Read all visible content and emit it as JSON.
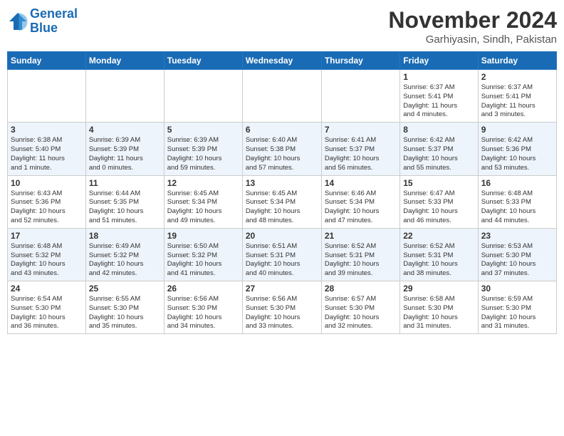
{
  "header": {
    "logo_line1": "General",
    "logo_line2": "Blue",
    "month": "November 2024",
    "location": "Garhiyasin, Sindh, Pakistan"
  },
  "weekdays": [
    "Sunday",
    "Monday",
    "Tuesday",
    "Wednesday",
    "Thursday",
    "Friday",
    "Saturday"
  ],
  "weeks": [
    [
      {
        "day": "",
        "info": ""
      },
      {
        "day": "",
        "info": ""
      },
      {
        "day": "",
        "info": ""
      },
      {
        "day": "",
        "info": ""
      },
      {
        "day": "",
        "info": ""
      },
      {
        "day": "1",
        "info": "Sunrise: 6:37 AM\nSunset: 5:41 PM\nDaylight: 11 hours\nand 4 minutes."
      },
      {
        "day": "2",
        "info": "Sunrise: 6:37 AM\nSunset: 5:41 PM\nDaylight: 11 hours\nand 3 minutes."
      }
    ],
    [
      {
        "day": "3",
        "info": "Sunrise: 6:38 AM\nSunset: 5:40 PM\nDaylight: 11 hours\nand 1 minute."
      },
      {
        "day": "4",
        "info": "Sunrise: 6:39 AM\nSunset: 5:39 PM\nDaylight: 11 hours\nand 0 minutes."
      },
      {
        "day": "5",
        "info": "Sunrise: 6:39 AM\nSunset: 5:39 PM\nDaylight: 10 hours\nand 59 minutes."
      },
      {
        "day": "6",
        "info": "Sunrise: 6:40 AM\nSunset: 5:38 PM\nDaylight: 10 hours\nand 57 minutes."
      },
      {
        "day": "7",
        "info": "Sunrise: 6:41 AM\nSunset: 5:37 PM\nDaylight: 10 hours\nand 56 minutes."
      },
      {
        "day": "8",
        "info": "Sunrise: 6:42 AM\nSunset: 5:37 PM\nDaylight: 10 hours\nand 55 minutes."
      },
      {
        "day": "9",
        "info": "Sunrise: 6:42 AM\nSunset: 5:36 PM\nDaylight: 10 hours\nand 53 minutes."
      }
    ],
    [
      {
        "day": "10",
        "info": "Sunrise: 6:43 AM\nSunset: 5:36 PM\nDaylight: 10 hours\nand 52 minutes."
      },
      {
        "day": "11",
        "info": "Sunrise: 6:44 AM\nSunset: 5:35 PM\nDaylight: 10 hours\nand 51 minutes."
      },
      {
        "day": "12",
        "info": "Sunrise: 6:45 AM\nSunset: 5:34 PM\nDaylight: 10 hours\nand 49 minutes."
      },
      {
        "day": "13",
        "info": "Sunrise: 6:45 AM\nSunset: 5:34 PM\nDaylight: 10 hours\nand 48 minutes."
      },
      {
        "day": "14",
        "info": "Sunrise: 6:46 AM\nSunset: 5:34 PM\nDaylight: 10 hours\nand 47 minutes."
      },
      {
        "day": "15",
        "info": "Sunrise: 6:47 AM\nSunset: 5:33 PM\nDaylight: 10 hours\nand 46 minutes."
      },
      {
        "day": "16",
        "info": "Sunrise: 6:48 AM\nSunset: 5:33 PM\nDaylight: 10 hours\nand 44 minutes."
      }
    ],
    [
      {
        "day": "17",
        "info": "Sunrise: 6:48 AM\nSunset: 5:32 PM\nDaylight: 10 hours\nand 43 minutes."
      },
      {
        "day": "18",
        "info": "Sunrise: 6:49 AM\nSunset: 5:32 PM\nDaylight: 10 hours\nand 42 minutes."
      },
      {
        "day": "19",
        "info": "Sunrise: 6:50 AM\nSunset: 5:32 PM\nDaylight: 10 hours\nand 41 minutes."
      },
      {
        "day": "20",
        "info": "Sunrise: 6:51 AM\nSunset: 5:31 PM\nDaylight: 10 hours\nand 40 minutes."
      },
      {
        "day": "21",
        "info": "Sunrise: 6:52 AM\nSunset: 5:31 PM\nDaylight: 10 hours\nand 39 minutes."
      },
      {
        "day": "22",
        "info": "Sunrise: 6:52 AM\nSunset: 5:31 PM\nDaylight: 10 hours\nand 38 minutes."
      },
      {
        "day": "23",
        "info": "Sunrise: 6:53 AM\nSunset: 5:30 PM\nDaylight: 10 hours\nand 37 minutes."
      }
    ],
    [
      {
        "day": "24",
        "info": "Sunrise: 6:54 AM\nSunset: 5:30 PM\nDaylight: 10 hours\nand 36 minutes."
      },
      {
        "day": "25",
        "info": "Sunrise: 6:55 AM\nSunset: 5:30 PM\nDaylight: 10 hours\nand 35 minutes."
      },
      {
        "day": "26",
        "info": "Sunrise: 6:56 AM\nSunset: 5:30 PM\nDaylight: 10 hours\nand 34 minutes."
      },
      {
        "day": "27",
        "info": "Sunrise: 6:56 AM\nSunset: 5:30 PM\nDaylight: 10 hours\nand 33 minutes."
      },
      {
        "day": "28",
        "info": "Sunrise: 6:57 AM\nSunset: 5:30 PM\nDaylight: 10 hours\nand 32 minutes."
      },
      {
        "day": "29",
        "info": "Sunrise: 6:58 AM\nSunset: 5:30 PM\nDaylight: 10 hours\nand 31 minutes."
      },
      {
        "day": "30",
        "info": "Sunrise: 6:59 AM\nSunset: 5:30 PM\nDaylight: 10 hours\nand 31 minutes."
      }
    ]
  ]
}
